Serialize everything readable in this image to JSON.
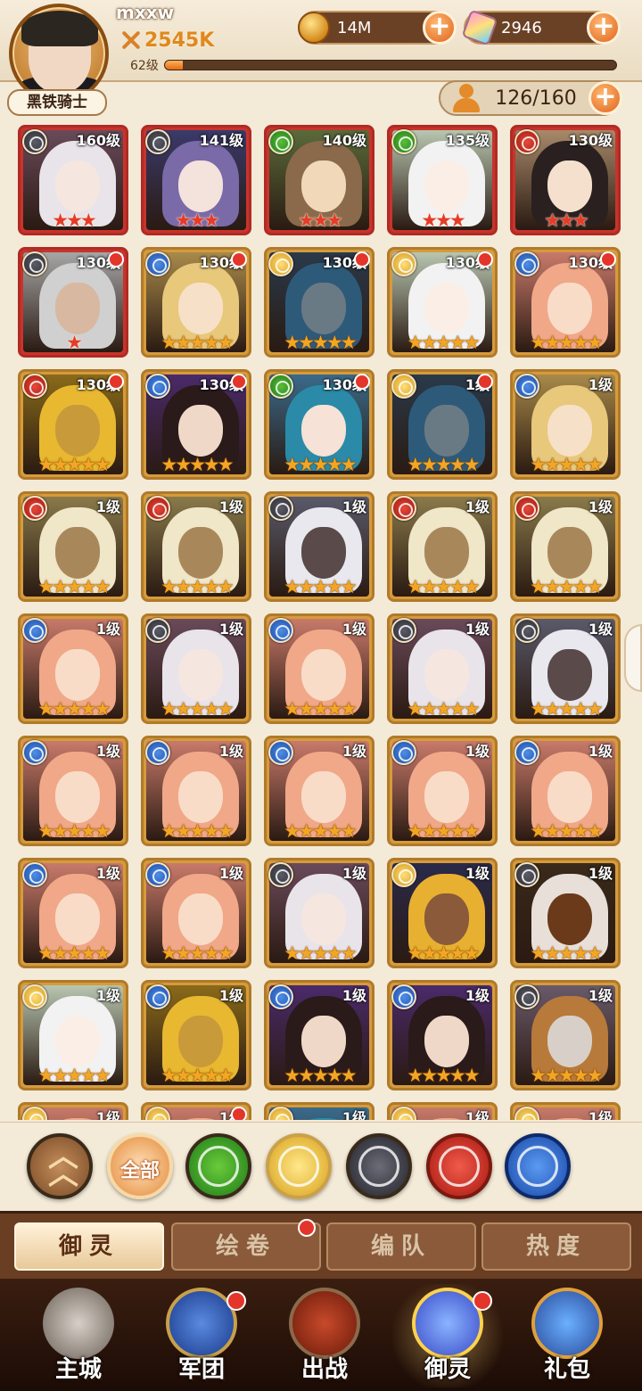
{
  "player": {
    "name": "mxxw",
    "power": "2545K",
    "level_label": "62级",
    "level_progress": 0.04,
    "rank": "黑铁骑士"
  },
  "resources": {
    "gold": "14M",
    "gems": "2946",
    "hero_slots": "126/160"
  },
  "element_icons": {
    "dark": "dark-web-icon",
    "fire": "fire-bird-icon",
    "water": "water-wave-icon",
    "wind": "wind-icon",
    "light": "rose-icon"
  },
  "heroes": [
    {
      "level": "160级",
      "element": "dark",
      "stars": "★★★",
      "rarity": "red",
      "palette": "silver"
    },
    {
      "level": "141级",
      "element": "dark",
      "stars": "★★★",
      "rarity": "red",
      "palette": "hood"
    },
    {
      "level": "140级",
      "element": "wind",
      "stars": "★★★",
      "rarity": "red",
      "palette": "brown"
    },
    {
      "level": "135级",
      "element": "wind",
      "stars": "★★★",
      "rarity": "red",
      "palette": "white"
    },
    {
      "level": "130级",
      "element": "fire",
      "stars": "★★★",
      "rarity": "red",
      "palette": "black"
    },
    {
      "level": "130级",
      "element": "dark",
      "stars": "★",
      "rarity": "red",
      "palette": "grey",
      "badge": true
    },
    {
      "level": "130级",
      "element": "water",
      "stars": "★★★★★",
      "rarity": "gold",
      "palette": "blond",
      "badge": true
    },
    {
      "level": "130级",
      "element": "light",
      "stars": "★★★★★",
      "rarity": "gold",
      "palette": "helm",
      "badge": true
    },
    {
      "level": "130级",
      "element": "light",
      "stars": "★★★★★",
      "rarity": "gold",
      "palette": "white",
      "badge": true
    },
    {
      "level": "130级",
      "element": "water",
      "stars": "★★★★★",
      "rarity": "gold",
      "palette": "pink",
      "badge": true
    },
    {
      "level": "130级",
      "element": "fire",
      "stars": "★★★★★",
      "rarity": "gold",
      "palette": "goldhelm",
      "badge": true
    },
    {
      "level": "130级",
      "element": "water",
      "stars": "★★★★★",
      "rarity": "gold",
      "palette": "dark",
      "badge": true
    },
    {
      "level": "130级",
      "element": "wind",
      "stars": "★★★★★",
      "rarity": "gold",
      "palette": "teal",
      "badge": true
    },
    {
      "level": "1级",
      "element": "light",
      "stars": "★★★★★",
      "rarity": "gold",
      "palette": "helm",
      "badge": true
    },
    {
      "level": "1级",
      "element": "water",
      "stars": "★★★★★",
      "rarity": "gold",
      "palette": "blond"
    },
    {
      "level": "1级",
      "element": "fire",
      "stars": "★★★★★",
      "rarity": "gold",
      "palette": "paladin"
    },
    {
      "level": "1级",
      "element": "fire",
      "stars": "★★★★★",
      "rarity": "gold",
      "palette": "paladin"
    },
    {
      "level": "1级",
      "element": "dark",
      "stars": "★★★★★",
      "rarity": "gold",
      "palette": "darkskin"
    },
    {
      "level": "1级",
      "element": "fire",
      "stars": "★★★★★",
      "rarity": "gold",
      "palette": "paladin"
    },
    {
      "level": "1级",
      "element": "fire",
      "stars": "★★★★★",
      "rarity": "gold",
      "palette": "paladin"
    },
    {
      "level": "1级",
      "element": "water",
      "stars": "★★★★★",
      "rarity": "gold",
      "palette": "pink"
    },
    {
      "level": "1级",
      "element": "dark",
      "stars": "★★★★★",
      "rarity": "gold",
      "palette": "silver"
    },
    {
      "level": "1级",
      "element": "water",
      "stars": "★★★★★",
      "rarity": "gold",
      "palette": "pink"
    },
    {
      "level": "1级",
      "element": "dark",
      "stars": "★★★★★",
      "rarity": "gold",
      "palette": "silver"
    },
    {
      "level": "1级",
      "element": "dark",
      "stars": "★★★★★",
      "rarity": "gold",
      "palette": "darkskin"
    },
    {
      "level": "1级",
      "element": "water",
      "stars": "★★★★★",
      "rarity": "gold",
      "palette": "pink"
    },
    {
      "level": "1级",
      "element": "water",
      "stars": "★★★★★",
      "rarity": "gold",
      "palette": "pink"
    },
    {
      "level": "1级",
      "element": "water",
      "stars": "★★★★★",
      "rarity": "gold",
      "palette": "pink"
    },
    {
      "level": "1级",
      "element": "water",
      "stars": "★★★★★",
      "rarity": "gold",
      "palette": "pink"
    },
    {
      "level": "1级",
      "element": "water",
      "stars": "★★★★★",
      "rarity": "gold",
      "palette": "pink"
    },
    {
      "level": "1级",
      "element": "water",
      "stars": "★★★★★",
      "rarity": "gold",
      "palette": "pink"
    },
    {
      "level": "1级",
      "element": "water",
      "stars": "★★★★★",
      "rarity": "gold",
      "palette": "pink"
    },
    {
      "level": "1级",
      "element": "dark",
      "stars": "★★★★★",
      "rarity": "gold",
      "palette": "silver"
    },
    {
      "level": "1级",
      "element": "light",
      "stars": "★★★★★",
      "rarity": "gold",
      "palette": "egypt"
    },
    {
      "level": "1级",
      "element": "dark",
      "stars": "★★★★★",
      "rarity": "gold",
      "palette": "minotaur"
    },
    {
      "level": "1级",
      "element": "light",
      "stars": "★★★★★",
      "rarity": "gold",
      "palette": "white"
    },
    {
      "level": "1级",
      "element": "water",
      "stars": "★★★★★",
      "rarity": "gold",
      "palette": "goldhelm"
    },
    {
      "level": "1级",
      "element": "water",
      "stars": "★★★★★",
      "rarity": "gold",
      "palette": "dark"
    },
    {
      "level": "1级",
      "element": "water",
      "stars": "★★★★★",
      "rarity": "gold",
      "palette": "dark"
    },
    {
      "level": "1级",
      "element": "dark",
      "stars": "★★★★★",
      "rarity": "gold",
      "palette": "mask"
    },
    {
      "level": "1级",
      "element": "light",
      "stars": "",
      "rarity": "gold",
      "palette": "pink"
    },
    {
      "level": "1级",
      "element": "light",
      "stars": "",
      "rarity": "gold",
      "palette": "pink",
      "badge": true
    },
    {
      "level": "1级",
      "element": "light",
      "stars": "",
      "rarity": "gold",
      "palette": "teal"
    },
    {
      "level": "1级",
      "element": "light",
      "stars": "",
      "rarity": "gold",
      "palette": "pink"
    },
    {
      "level": "1级",
      "element": "light",
      "stars": "",
      "rarity": "gold",
      "palette": "pink"
    }
  ],
  "filters": {
    "collapse_icon": "chevron-up-icon",
    "all_label": "全部",
    "items": [
      "wind",
      "light",
      "dark",
      "fire",
      "water"
    ]
  },
  "subtabs": [
    {
      "label": "御灵",
      "active": true
    },
    {
      "label": "绘卷",
      "badge": true
    },
    {
      "label": "编队"
    },
    {
      "label": "热度"
    }
  ],
  "bottom_nav": [
    {
      "label": "主城",
      "icon": "castle-icon"
    },
    {
      "label": "军团",
      "icon": "legion-shield-icon",
      "badge": true
    },
    {
      "label": "出战",
      "icon": "battle-gate-icon"
    },
    {
      "label": "御灵",
      "icon": "crystal-icon",
      "badge": true,
      "active": true
    },
    {
      "label": "礼包",
      "icon": "gift-shop-icon"
    }
  ],
  "colors": {
    "background": "#f4ead8",
    "accent_orange": "#e0641c",
    "badge_red": "#e4352a",
    "card_gold": "#d69b3c",
    "card_red": "#c7342c"
  }
}
